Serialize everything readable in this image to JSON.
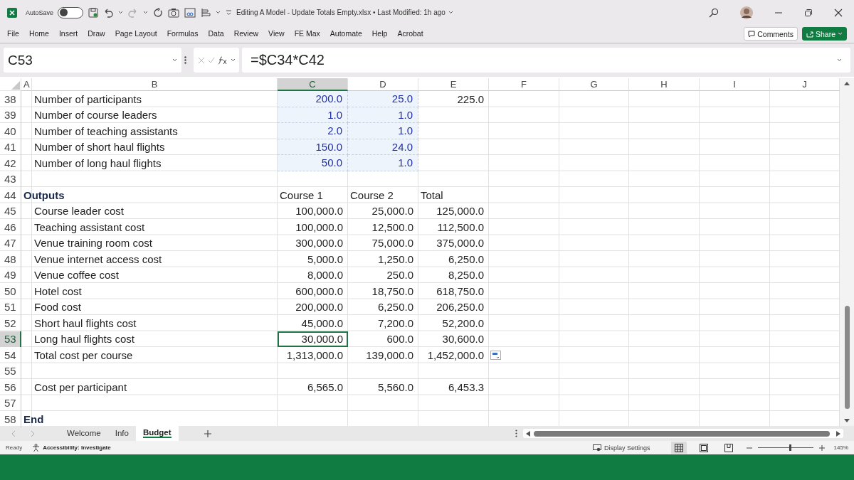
{
  "window": {
    "title": "Editing A Model - Update Totals Empty.xlsx • Last Modified: 1h ago",
    "autosave": {
      "label": "AutoSave",
      "on": false
    }
  },
  "ribbon_tabs": [
    {
      "label": "File",
      "selected": false
    },
    {
      "label": "Home",
      "selected": false
    },
    {
      "label": "Insert",
      "selected": false
    },
    {
      "label": "Draw",
      "selected": false
    },
    {
      "label": "Page Layout",
      "selected": false
    },
    {
      "label": "Formulas",
      "selected": false
    },
    {
      "label": "Data",
      "selected": false
    },
    {
      "label": "Review",
      "selected": false
    },
    {
      "label": "View",
      "selected": false
    },
    {
      "label": "FE Max",
      "selected": false
    },
    {
      "label": "Automate",
      "selected": false
    },
    {
      "label": "Help",
      "selected": false
    },
    {
      "label": "Acrobat",
      "selected": false
    }
  ],
  "ribbon_buttons": [
    {
      "label": "Comments",
      "kind": "outline"
    },
    {
      "label": "Share",
      "kind": "primary"
    }
  ],
  "formula_bar": {
    "name_box": "C53",
    "formula": "=$C34*C42"
  },
  "columns": [
    {
      "label": "A",
      "selected": false
    },
    {
      "label": "B",
      "selected": false
    },
    {
      "label": "C",
      "selected": true
    },
    {
      "label": "D",
      "selected": false
    },
    {
      "label": "E",
      "selected": false
    },
    {
      "label": "F",
      "selected": false
    },
    {
      "label": "G",
      "selected": false
    },
    {
      "label": "H",
      "selected": false
    },
    {
      "label": "I",
      "selected": false
    },
    {
      "label": "J",
      "selected": false
    }
  ],
  "rows": [
    {
      "number": "38",
      "kind": "item",
      "label": "Number of participants",
      "selected": false,
      "cells": [
        {
          "value": "200.0",
          "input": true
        },
        {
          "value": "25.0",
          "input": true
        },
        {
          "value": "225.0",
          "input": false
        }
      ]
    },
    {
      "number": "39",
      "kind": "item",
      "label": "Number of course leaders",
      "selected": false,
      "cells": [
        {
          "value": "1.0",
          "input": true
        },
        {
          "value": "1.0",
          "input": true
        },
        null
      ]
    },
    {
      "number": "40",
      "kind": "item",
      "label": "Number of teaching assistants",
      "selected": false,
      "cells": [
        {
          "value": "2.0",
          "input": true
        },
        {
          "value": "1.0",
          "input": true
        },
        null
      ]
    },
    {
      "number": "41",
      "kind": "item",
      "label": "Number of short haul flights",
      "selected": false,
      "cells": [
        {
          "value": "150.0",
          "input": true
        },
        {
          "value": "24.0",
          "input": true
        },
        null
      ]
    },
    {
      "number": "42",
      "kind": "item",
      "label": "Number of long haul flights",
      "selected": false,
      "cells": [
        {
          "value": "50.0",
          "input": true
        },
        {
          "value": "1.0",
          "input": true
        },
        null
      ]
    },
    {
      "number": "43",
      "kind": "blank",
      "selected": false,
      "cells": [
        null,
        null,
        null
      ]
    },
    {
      "number": "44",
      "kind": "heading",
      "label": "Outputs",
      "selected": false,
      "cells": [
        {
          "value": "Course 1",
          "input": false
        },
        {
          "value": "Course 2",
          "input": false
        },
        {
          "value": "Total",
          "input": false
        }
      ]
    },
    {
      "number": "45",
      "kind": "item",
      "label": "Course leader cost",
      "selected": false,
      "cells": [
        {
          "value": "100,000.0",
          "input": false
        },
        {
          "value": "25,000.0",
          "input": false
        },
        {
          "value": "125,000.0",
          "input": false
        }
      ]
    },
    {
      "number": "46",
      "kind": "item",
      "label": "Teaching assistant cost",
      "selected": false,
      "cells": [
        {
          "value": "100,000.0",
          "input": false
        },
        {
          "value": "12,500.0",
          "input": false
        },
        {
          "value": "112,500.0",
          "input": false
        }
      ]
    },
    {
      "number": "47",
      "kind": "item",
      "label": "Venue training room cost",
      "selected": false,
      "cells": [
        {
          "value": "300,000.0",
          "input": false
        },
        {
          "value": "75,000.0",
          "input": false
        },
        {
          "value": "375,000.0",
          "input": false
        }
      ]
    },
    {
      "number": "48",
      "kind": "item",
      "label": "Venue internet access cost",
      "selected": false,
      "cells": [
        {
          "value": "5,000.0",
          "input": false
        },
        {
          "value": "1,250.0",
          "input": false
        },
        {
          "value": "6,250.0",
          "input": false
        }
      ]
    },
    {
      "number": "49",
      "kind": "item",
      "label": "Venue coffee cost",
      "selected": false,
      "cells": [
        {
          "value": "8,000.0",
          "input": false
        },
        {
          "value": "250.0",
          "input": false
        },
        {
          "value": "8,250.0",
          "input": false
        }
      ]
    },
    {
      "number": "50",
      "kind": "item",
      "label": "Hotel cost",
      "selected": false,
      "cells": [
        {
          "value": "600,000.0",
          "input": false
        },
        {
          "value": "18,750.0",
          "input": false
        },
        {
          "value": "618,750.0",
          "input": false
        }
      ]
    },
    {
      "number": "51",
      "kind": "item",
      "label": "Food cost",
      "selected": false,
      "cells": [
        {
          "value": "200,000.0",
          "input": false
        },
        {
          "value": "6,250.0",
          "input": false
        },
        {
          "value": "206,250.0",
          "input": false
        }
      ]
    },
    {
      "number": "52",
      "kind": "item",
      "label": "Short haul flights cost",
      "selected": false,
      "cells": [
        {
          "value": "45,000.0",
          "input": false
        },
        {
          "value": "7,200.0",
          "input": false
        },
        {
          "value": "52,200.0",
          "input": false
        }
      ]
    },
    {
      "number": "53",
      "kind": "item",
      "label": "Long haul flights cost",
      "selected": true,
      "cells": [
        {
          "value": "30,000.0",
          "input": false
        },
        {
          "value": "600.0",
          "input": false
        },
        {
          "value": "30,600.0",
          "input": false
        }
      ]
    },
    {
      "number": "54",
      "kind": "item",
      "label": "Total cost per course",
      "selected": false,
      "paste_options": true,
      "cells": [
        {
          "value": "1,313,000.0",
          "input": false
        },
        {
          "value": "139,000.0",
          "input": false
        },
        {
          "value": "1,452,000.0",
          "input": false
        }
      ]
    },
    {
      "number": "55",
      "kind": "blank",
      "selected": false,
      "cells": [
        null,
        null,
        null
      ]
    },
    {
      "number": "56",
      "kind": "item",
      "label": "Cost per participant",
      "selected": false,
      "cells": [
        {
          "value": "6,565.0",
          "input": false
        },
        {
          "value": "5,560.0",
          "input": false
        },
        {
          "value": "6,453.3",
          "input": false
        }
      ]
    },
    {
      "number": "57",
      "kind": "blank",
      "selected": false,
      "cells": [
        null,
        null,
        null
      ]
    },
    {
      "number": "58",
      "kind": "heading",
      "label": "End",
      "selected": false,
      "cells": [
        null,
        null,
        null
      ]
    }
  ],
  "sheet_tabs": [
    {
      "label": "Welcome",
      "selected": false
    },
    {
      "label": "Info",
      "selected": false
    },
    {
      "label": "Budget",
      "selected": true
    }
  ],
  "status_bar": {
    "ready": "Ready",
    "accessibility": "Accessibility: Investigate",
    "display_settings": "Display Settings",
    "views": [
      {
        "kind": "normal",
        "selected": true
      },
      {
        "kind": "page_layout",
        "selected": false
      },
      {
        "kind": "page_break",
        "selected": false
      }
    ],
    "zoom": {
      "level": 0.59,
      "reading": "145%"
    }
  }
}
